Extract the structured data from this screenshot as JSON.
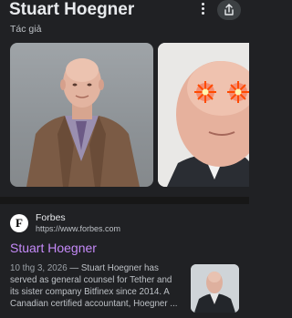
{
  "knowledge_panel": {
    "title": "Stuart Hoegner",
    "subtitle": "Tác giả",
    "menu_icon": "more-vert-icon",
    "share_icon": "share-icon"
  },
  "images": [
    {
      "description_icon": "portrait-photo"
    },
    {
      "description_icon": "meme-glowing-eyes-photo"
    }
  ],
  "result": {
    "favicon_letter": "F",
    "site_name": "Forbes",
    "site_url": "https://www.forbes.com",
    "title": "Stuart Hoegner",
    "date": "10 thg 3, 2026",
    "snippet": " — Stuart Hoegner has served as general counsel for Tether and its sister company Bitfinex since 2014. A Canadian certified accountant, Hoegner ..."
  },
  "colors": {
    "background": "#202124",
    "link_visited": "#c58af9",
    "text_secondary": "#bdc1c6"
  }
}
